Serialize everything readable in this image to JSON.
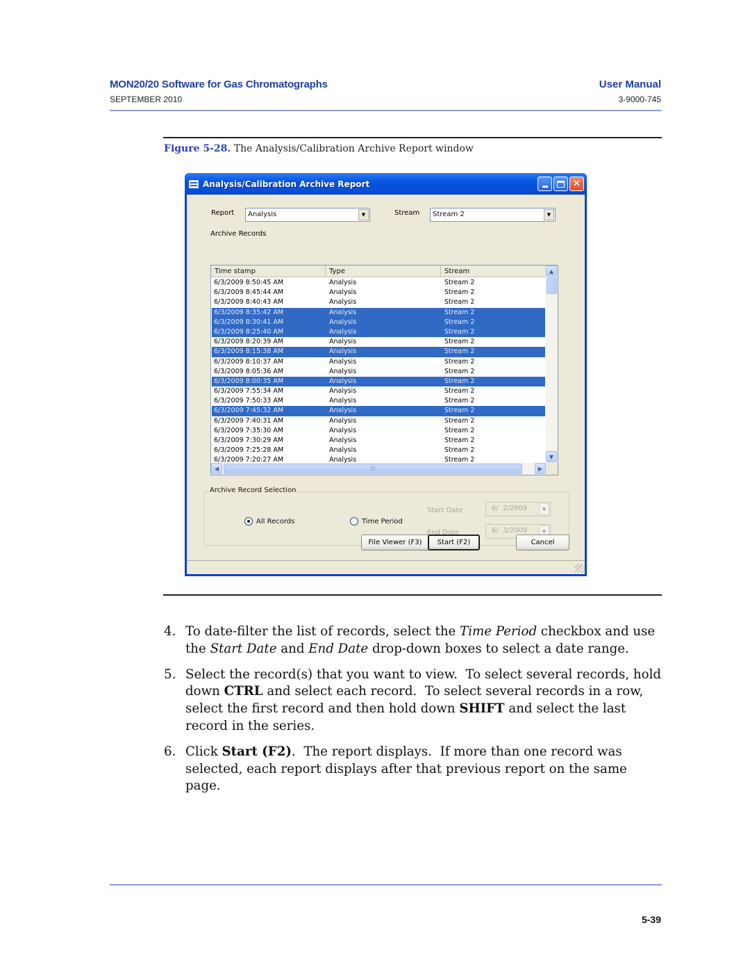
{
  "page_header": {
    "title": "MON20/20 Software for Gas Chromatographs",
    "date": "SEPTEMBER 2010",
    "doc_type": "User Manual",
    "doc_number": "3-9000-745"
  },
  "figure": {
    "label": "Figure 5-28.",
    "caption": "The Analysis/Calibration Archive Report window"
  },
  "window": {
    "title": "Analysis/Calibration Archive Report",
    "report_label": "Report",
    "report_value": "Analysis",
    "stream_label": "Stream",
    "stream_value": "Stream 2",
    "archive_records_label": "Archive Records",
    "columns": [
      "Time stamp",
      "Type",
      "Stream"
    ],
    "rows": [
      {
        "time": "6/3/2009 8:50:45 AM",
        "type": "Analysis",
        "stream": "Stream 2",
        "selected": false
      },
      {
        "time": "6/3/2009 8:45:44 AM",
        "type": "Analysis",
        "stream": "Stream 2",
        "selected": false
      },
      {
        "time": "6/3/2009 8:40:43 AM",
        "type": "Analysis",
        "stream": "Stream 2",
        "selected": false
      },
      {
        "time": "6/3/2009 8:35:42 AM",
        "type": "Analysis",
        "stream": "Stream 2",
        "selected": true
      },
      {
        "time": "6/3/2009 8:30:41 AM",
        "type": "Analysis",
        "stream": "Stream 2",
        "selected": true
      },
      {
        "time": "6/3/2009 8:25:40 AM",
        "type": "Analysis",
        "stream": "Stream 2",
        "selected": true
      },
      {
        "time": "6/3/2009 8:20:39 AM",
        "type": "Analysis",
        "stream": "Stream 2",
        "selected": false
      },
      {
        "time": "6/3/2009 8:15:38 AM",
        "type": "Analysis",
        "stream": "Stream 2",
        "selected": true
      },
      {
        "time": "6/3/2009 8:10:37 AM",
        "type": "Analysis",
        "stream": "Stream 2",
        "selected": false
      },
      {
        "time": "6/3/2009 8:05:36 AM",
        "type": "Analysis",
        "stream": "Stream 2",
        "selected": false
      },
      {
        "time": "6/3/2009 8:00:35 AM",
        "type": "Analysis",
        "stream": "Stream 2",
        "selected": true
      },
      {
        "time": "6/3/2009 7:55:34 AM",
        "type": "Analysis",
        "stream": "Stream 2",
        "selected": false
      },
      {
        "time": "6/3/2009 7:50:33 AM",
        "type": "Analysis",
        "stream": "Stream 2",
        "selected": false
      },
      {
        "time": "6/3/2009 7:45:32 AM",
        "type": "Analysis",
        "stream": "Stream 2",
        "selected": true
      },
      {
        "time": "6/3/2009 7:40:31 AM",
        "type": "Analysis",
        "stream": "Stream 2",
        "selected": false
      },
      {
        "time": "6/3/2009 7:35:30 AM",
        "type": "Analysis",
        "stream": "Stream 2",
        "selected": false
      },
      {
        "time": "6/3/2009 7:30:29 AM",
        "type": "Analysis",
        "stream": "Stream 2",
        "selected": false
      },
      {
        "time": "6/3/2009 7:25:28 AM",
        "type": "Analysis",
        "stream": "Stream 2",
        "selected": false
      },
      {
        "time": "6/3/2009 7:20:27 AM",
        "type": "Analysis",
        "stream": "Stream 2",
        "selected": false
      }
    ],
    "selection_group_label": "Archive Record Selection",
    "radio_all_records": "All Records",
    "radio_time_period": "Time Period",
    "selected_radio": "All Records",
    "start_date_label": "Start Date",
    "start_date_value": "6/  2/2009",
    "end_date_label": "End Date",
    "end_date_value": "6/  3/2009",
    "file_viewer_button": "File Viewer (F3)",
    "start_button": "Start (F2)",
    "cancel_button": "Cancel"
  },
  "steps": [
    {
      "num": "4.",
      "html": "To date-filter the list of records, select the <i>Time Period</i> checkbox and use the <i>Start Date</i> and <i>End Date</i> drop-down boxes to select a date range."
    },
    {
      "num": "5.",
      "html": "Select the record(s) that you want to view.&nbsp; To select several records, hold down <b>CTRL</b> and select each record.&nbsp; To select several records in a row, select the first record and then hold down <b>SHIFT</b> and select the last record in the series."
    },
    {
      "num": "6.",
      "html": "Click <b>Start (F2)</b>.&nbsp; The report displays.&nbsp; If more than one record was selected, each report displays after that previous report on the same page."
    }
  ],
  "page_number": "5-39",
  "colors": {
    "header_blue": "#1f3f9f",
    "rule_blue": "#8e9ad8",
    "selection_blue": "#316ac5",
    "titlebar_blue": "#0a4fd7"
  }
}
